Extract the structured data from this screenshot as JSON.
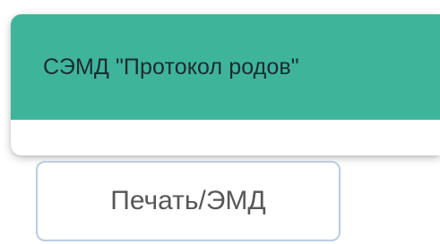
{
  "tooltip": {
    "title": "СЭМД \"Протокол родов\"",
    "header_color": "#3eb59b"
  },
  "actions": {
    "print_label": "Печать/ЭМД"
  }
}
